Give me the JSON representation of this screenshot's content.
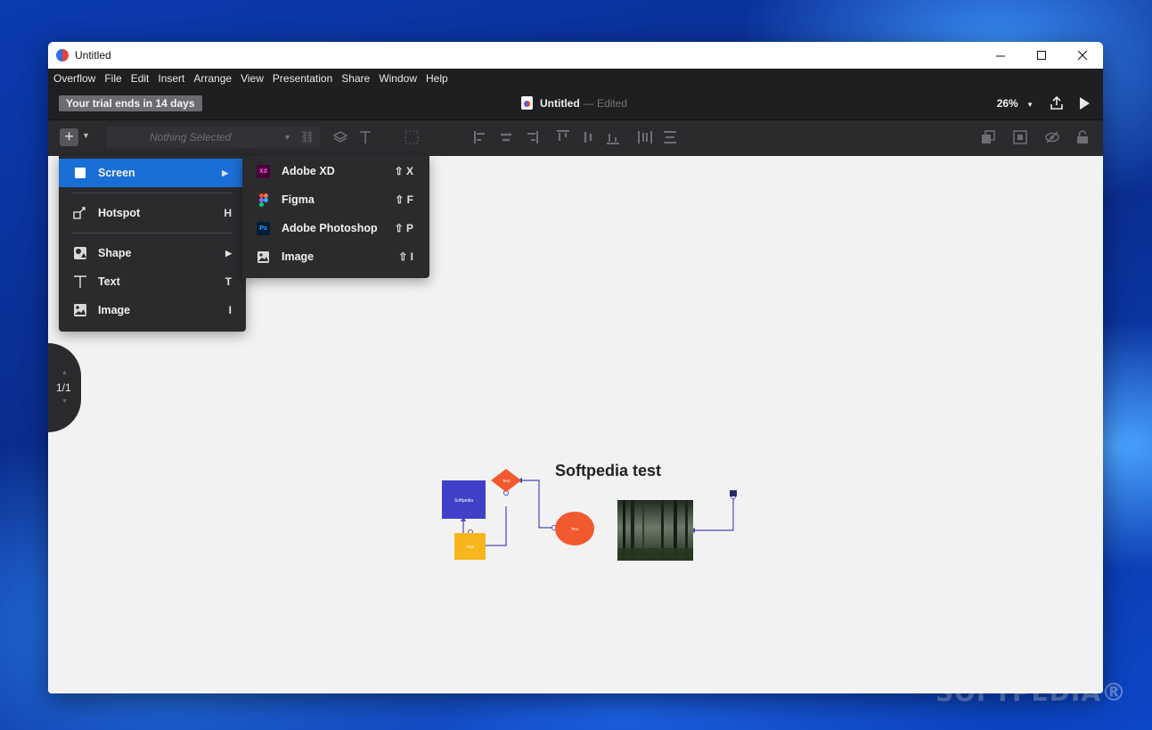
{
  "window": {
    "title": "Untitled"
  },
  "menubar": [
    "Overflow",
    "File",
    "Edit",
    "Insert",
    "Arrange",
    "View",
    "Presentation",
    "Share",
    "Window",
    "Help"
  ],
  "toolbar": {
    "trial_badge": "Your trial ends in 14 days",
    "doc_title": "Untitled",
    "doc_status": "— Edited",
    "zoom": "26%",
    "selection_placeholder": "Nothing Selected"
  },
  "insert_menu": {
    "items": [
      {
        "label": "Screen",
        "shortcut": "",
        "submenu": true,
        "icon": "screen-icon"
      },
      {
        "label": "Hotspot",
        "shortcut": "H",
        "submenu": false,
        "icon": "hotspot-icon"
      },
      {
        "label": "Shape",
        "shortcut": "",
        "submenu": true,
        "icon": "shape-icon"
      },
      {
        "label": "Text",
        "shortcut": "T",
        "submenu": false,
        "icon": "text-icon"
      },
      {
        "label": "Image",
        "shortcut": "I",
        "submenu": false,
        "icon": "image-icon"
      }
    ]
  },
  "screen_submenu": {
    "items": [
      {
        "label": "Adobe XD",
        "shortcut": "⇧ X",
        "icon": "adobe-xd-icon",
        "badge": "Xd"
      },
      {
        "label": "Figma",
        "shortcut": "⇧ F",
        "icon": "figma-icon"
      },
      {
        "label": "Adobe Photoshop",
        "shortcut": "⇧ P",
        "icon": "photoshop-icon",
        "badge": "Ps"
      },
      {
        "label": "Image",
        "shortcut": "⇧ I",
        "icon": "image-icon"
      }
    ]
  },
  "page_indicator": "1/1",
  "diagram": {
    "title": "Softpedia test",
    "nodes": {
      "square": "Softpedia",
      "diamond": "Text",
      "yellow": "Text",
      "ellipse": "Text"
    }
  },
  "watermark": "SOFTPEDIA®",
  "colors": {
    "accent": "#1a6fd6",
    "node_blue": "#3f3fc8",
    "node_orange": "#f05a2e",
    "node_yellow": "#f7b51e",
    "connector": "#4a4ab8"
  }
}
